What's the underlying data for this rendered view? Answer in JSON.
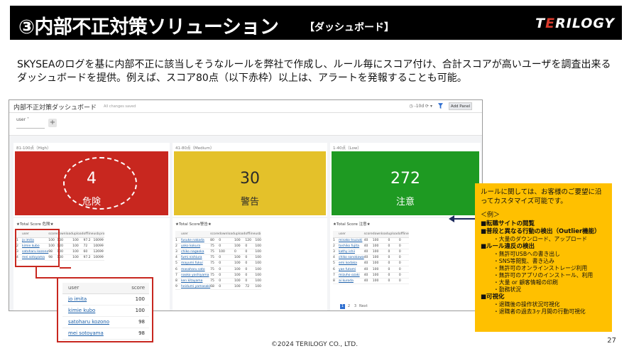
{
  "header": {
    "title": "③内部不正対策ソリューション",
    "subtitle": "【ダッシュボード】",
    "logo": "TERILOGY"
  },
  "description": "SKYSEAのログを基に内部不正に該当しそうなルールを弊社で作成し、ルール毎にスコア付け、合計スコアが高いユーザを調査出来るダッシュボードを提供。例えば、スコア80点（以下赤枠）以上は、アラートを発報することも可能。",
  "dashboard": {
    "title": "内部不正対策ダッシュボード",
    "saved": "All changes saved",
    "time": "-10d",
    "add_panel": "Add Panel",
    "filter_label": "user",
    "plus": "+",
    "tiles": [
      {
        "label": "81-100点（High）",
        "value": "4",
        "word": "危険",
        "color": "#c8271f"
      },
      {
        "label": "41-80点（Medium）",
        "value": "30",
        "word": "警告",
        "color": "#e4c12a"
      },
      {
        "label": "1-40点（Low）",
        "value": "272",
        "word": "注意",
        "color": "#1e9a22"
      }
    ],
    "panels": [
      {
        "title": "★Total Score 危険★",
        "columns": [
          "user",
          "score",
          "download",
          "upload",
          "offline",
          "usb",
          "pro"
        ],
        "rows": [
          [
            "jo imita",
            "100",
            "100",
            "100",
            "97.2",
            "100",
            "99"
          ],
          [
            "kimie kubo",
            "100",
            "120",
            "100",
            "72",
            "100",
            "99"
          ],
          [
            "satoharu kozono",
            "98",
            "100",
            "100",
            "60",
            "126",
            "99"
          ],
          [
            "mei sotoyama",
            "98",
            "100",
            "100",
            "97.2",
            "100",
            "99"
          ]
        ]
      },
      {
        "title": "★Total Score警告★",
        "columns": [
          "user",
          "score",
          "download",
          "upload",
          "offline",
          "usb"
        ],
        "rows": [
          [
            "fusuke nakada",
            "80",
            "0",
            "100",
            "120",
            "100"
          ],
          [
            "yoko kokura",
            "75",
            "0",
            "100",
            "0",
            "100"
          ],
          [
            "chiko nagaoka",
            "75",
            "100",
            "0",
            "0",
            "100"
          ],
          [
            "fumi nishiura",
            "75",
            "0",
            "100",
            "0",
            "100"
          ],
          [
            "mayumi fukui",
            "75",
            "0",
            "100",
            "0",
            "100"
          ],
          [
            "masaharu sato",
            "75",
            "0",
            "100",
            "0",
            "100"
          ],
          [
            "naoko yoshiyama",
            "75",
            "0",
            "100",
            "0",
            "100"
          ],
          [
            "ken kitayama",
            "75",
            "0",
            "100",
            "0",
            "100"
          ],
          [
            "heidumi yamasaki",
            "68",
            "0",
            "100",
            "72",
            "100"
          ]
        ]
      },
      {
        "title": "★Total Score 注意★",
        "columns": [
          "user",
          "score",
          "download",
          "upload",
          "offline"
        ],
        "rows": [
          [
            "misako tsuzuki",
            "40",
            "100",
            "0",
            "0"
          ],
          [
            "toshiko fujita",
            "40",
            "100",
            "0",
            "0"
          ],
          [
            "kathy ishii",
            "40",
            "100",
            "0",
            "0"
          ],
          [
            "chiko sonokawa",
            "40",
            "100",
            "0",
            "0"
          ],
          [
            "emi kodaka",
            "40",
            "100",
            "0",
            "0"
          ],
          [
            "yae futami",
            "40",
            "100",
            "0",
            "0"
          ],
          [
            "mizuho ozaki",
            "40",
            "100",
            "0",
            "0"
          ],
          [
            "ai kuroda",
            "40",
            "100",
            "0",
            "0"
          ]
        ],
        "pager": [
          "1",
          "2",
          "3",
          "Next"
        ]
      }
    ]
  },
  "zoom_table": {
    "columns": [
      "user",
      "score"
    ],
    "rows": [
      [
        "jo imita",
        "100"
      ],
      [
        "kimie kubo",
        "100"
      ],
      [
        "satoharu kozono",
        "98"
      ],
      [
        "mei sotoyama",
        "98"
      ]
    ]
  },
  "note": {
    "intro": "ルールに関しては、お客様のご要望に沿ってカスタマイズ可能です。",
    "example": "＜例＞",
    "lines": [
      {
        "type": "h",
        "text": "■転職サイトの閲覧"
      },
      {
        "type": "h",
        "text": "■普段と異なる行動の検出（Outlier機能）"
      },
      {
        "type": "s",
        "text": "・大量のダウンロード、アップロード"
      },
      {
        "type": "h",
        "text": "■ルール違反の検出"
      },
      {
        "type": "s",
        "text": "・無許可USBへの書き出し"
      },
      {
        "type": "s",
        "text": "・SNS等閲覧、書き込み"
      },
      {
        "type": "s",
        "text": "・無許可のオンラインストレージ利用"
      },
      {
        "type": "s",
        "text": "・無許可のアプリのインストール、利用"
      },
      {
        "type": "s",
        "text": "・大量 or 顧客情報の印刷"
      },
      {
        "type": "s",
        "text": "・勤務状況"
      },
      {
        "type": "h",
        "text": "■可視化"
      },
      {
        "type": "s",
        "text": "・退職後の操作状況可視化"
      },
      {
        "type": "s",
        "text": "・退職者の過去3ヶ月間の行動可視化"
      }
    ]
  },
  "footer": "©2024 TERILOGY CO., LTD.",
  "page_number": "27"
}
